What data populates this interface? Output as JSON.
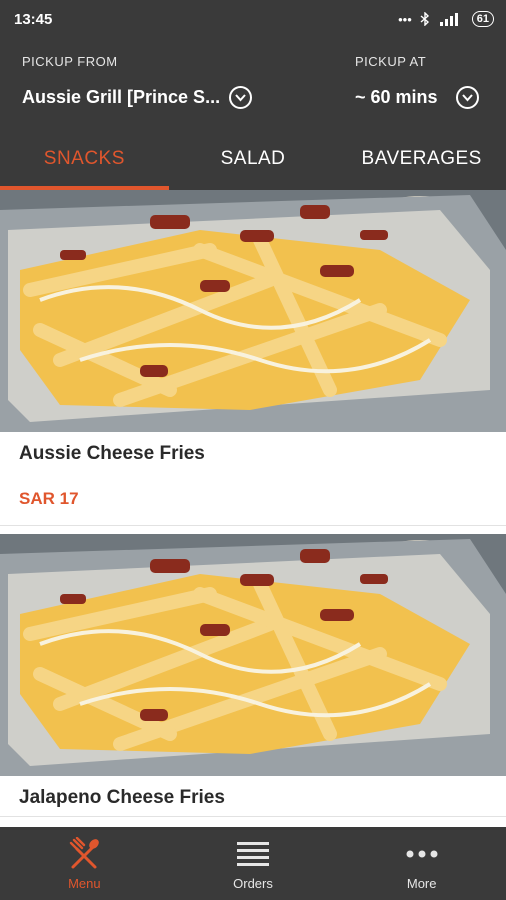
{
  "status_bar": {
    "time": "13:45",
    "icons": [
      "dots-icon",
      "bluetooth-icon",
      "signal-icon",
      "battery-icon"
    ],
    "battery": "61"
  },
  "header": {
    "pickup_from_label": "PICKUP FROM",
    "pickup_from_value": "Aussie Grill [Prince S...",
    "pickup_at_label": "PICKUP AT",
    "pickup_at_value": "~ 60 mins"
  },
  "tabs": [
    {
      "label": "SNACKS",
      "active": true
    },
    {
      "label": "SALAD",
      "active": false
    },
    {
      "label": "BAVERAGES",
      "active": false
    }
  ],
  "items": [
    {
      "title": "Aussie Cheese Fries",
      "price": "SAR 17",
      "image": "cheese-fries-photo"
    },
    {
      "title": "Jalapeno Cheese Fries",
      "image": "cheese-fries-photo"
    }
  ],
  "bottom_nav": [
    {
      "label": "Menu",
      "icon": "fork-spoon-icon",
      "active": true
    },
    {
      "label": "Orders",
      "icon": "list-icon",
      "active": false
    },
    {
      "label": "More",
      "icon": "more-dots-icon",
      "active": false
    }
  ],
  "colors": {
    "accent": "#e0562d",
    "bar_background": "#3a3a3a"
  }
}
